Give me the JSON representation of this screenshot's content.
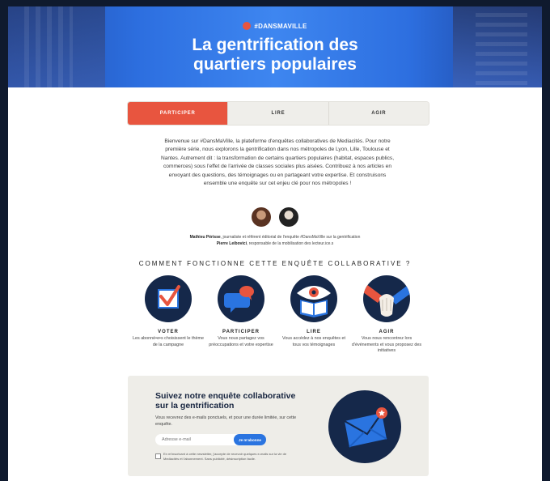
{
  "hero": {
    "tag": "#DANSMAVILLE",
    "title_line1": "La gentrification des",
    "title_line2": "quartiers populaires"
  },
  "tabs": [
    {
      "label": "PARTICIPER",
      "active": true
    },
    {
      "label": "LIRE",
      "active": false
    },
    {
      "label": "AGIR",
      "active": false
    }
  ],
  "intro": {
    "text": "Bienvenue sur #DansMaVille, la plateforme d'enquêtes collaboratives de Mediacités. Pour notre première série, nous explorons la gentrification dans nos métropoles de Lyon, Lille, Toulouse et Nantes. Autrement dit : la transformation de certains quartiers populaires (habitat, espaces publics, commerces) sous l'effet de l'arrivée de classes sociales plus aisées. Contribuez à nos articles en envoyant des questions, des témoignages ou en partageant votre expertise. Et construisons ensemble une enquête sur cet enjeu clé pour nos métropoles !"
  },
  "credits": {
    "author1_name": "Mathieu Périsse",
    "author1_role": ", journaliste et référent éditorial de l'enquête #DansMaVille sur la gentrification",
    "author2_name": "Pierre Leibovici",
    "author2_role": ", responsable de la mobilisation des lecteur.ice.s"
  },
  "how": {
    "title": "COMMENT FONCTIONNE CETTE ENQUÊTE COLLABORATIVE ?",
    "steps": [
      {
        "name": "VOTER",
        "desc": "Les abonné•e•s choisissent le thème de la campagne",
        "icon": "ballot-check-icon"
      },
      {
        "name": "PARTICIPER",
        "desc": "Vous nous partagez vos préoccupations et votre expertise",
        "icon": "speech-bubbles-icon"
      },
      {
        "name": "LIRE",
        "desc": "Vous accédez à nos enquêtes et tous vos témoignages",
        "icon": "eye-book-icon"
      },
      {
        "name": "AGIR",
        "desc": "Vous nous rencontrez lors d'événements et vous proposez des initiatives",
        "icon": "hands-icon"
      }
    ]
  },
  "newsletter": {
    "title_line1": "Suivez notre enquête collaborative",
    "title_line2": "sur la gentrification",
    "subtitle": "Vous recevrez des e-mails ponctuels, et pour une durée limitée, sur cette enquête.",
    "email_placeholder": "Adresse e-mail",
    "submit_label": "Je m'abonne",
    "consent": "En m'inscrivant à cette newsletter, j'accepte de recevoir quelques e-mails sur la vie de Mediacités et l'abonnement. Sans publicité, désinscription facile."
  },
  "colors": {
    "accent": "#e8553f",
    "navy": "#15284a",
    "blue": "#2a74e0"
  }
}
